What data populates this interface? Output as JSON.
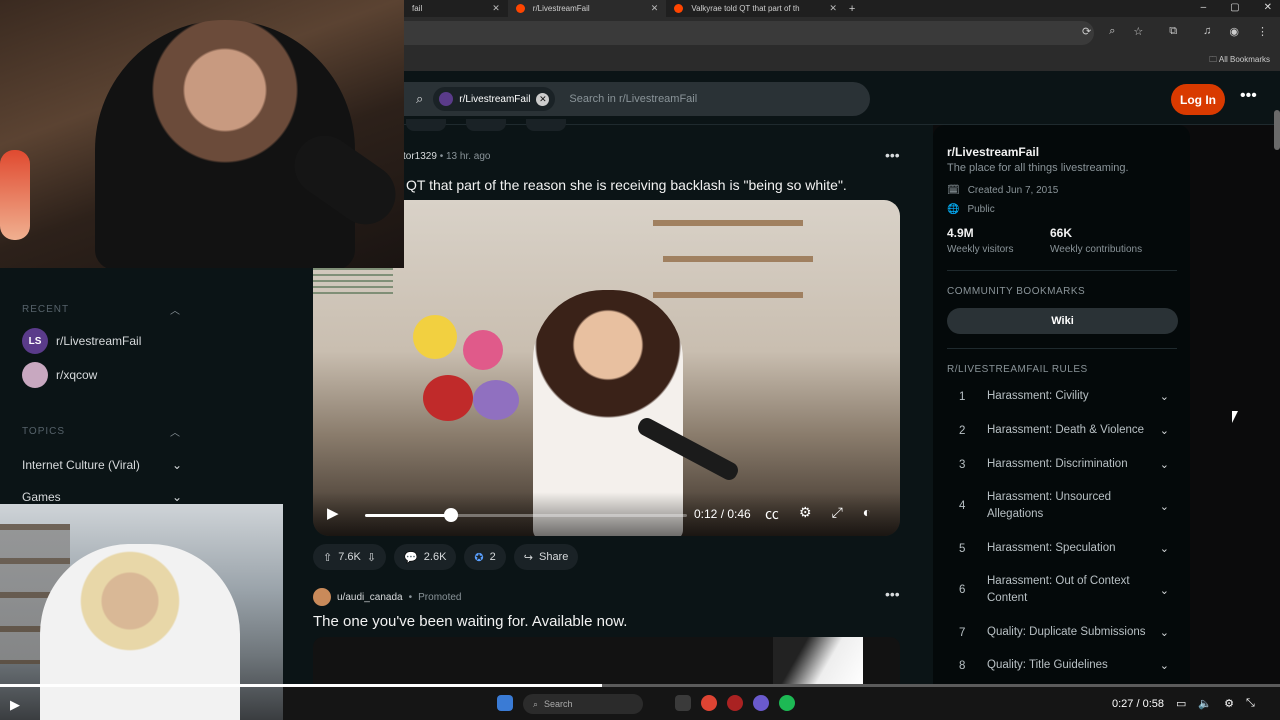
{
  "browser": {
    "tabs": [
      {
        "label": "fail"
      },
      {
        "label": "r/LivestreamFail",
        "active": true
      },
      {
        "label": "Valkyrae told QT that part of th"
      }
    ],
    "new_tab": "+",
    "bookmarks_label": "All Bookmarks"
  },
  "header": {
    "community_chip": "r/LivestreamFail",
    "search_placeholder": "Search in r/LivestreamFail",
    "login_label": "Log In",
    "menu_glyph": "•••"
  },
  "left_sidebar": {
    "recent_heading": "RECENT",
    "recent": [
      {
        "label": "r/LivestreamFail",
        "avatar": "LS",
        "color": "#5a3b8a"
      },
      {
        "label": "r/xqcow",
        "avatar": "",
        "color": "#c8a8c0"
      }
    ],
    "topics_heading": "TOPICS",
    "topics": [
      {
        "label": "Internet Culture (Viral)"
      },
      {
        "label": "Games"
      }
    ]
  },
  "post": {
    "author": "tor1329",
    "time": "13 hr. ago",
    "title": "QT that part of the reason she is receiving backlash is \"being so white\".",
    "video": {
      "time": "0:12 / 0:46",
      "progress": 0.26
    },
    "upvotes": "7.6K",
    "comments": "2.6K",
    "awards": "2",
    "share_label": "Share"
  },
  "promoted": {
    "author": "u/audi_canada",
    "tag": "Promoted",
    "title": "The one you've been waiting for. Available now."
  },
  "right_sidebar": {
    "title": "r/LivestreamFail",
    "description": "The place for all things livestreaming.",
    "created": "Created Jun 7, 2015",
    "visibility": "Public",
    "stats": [
      {
        "value": "4.9M",
        "label": "Weekly visitors"
      },
      {
        "value": "66K",
        "label": "Weekly contributions"
      }
    ],
    "bookmarks_heading": "COMMUNITY BOOKMARKS",
    "wiki_label": "Wiki",
    "rules_heading": "R/LIVESTREAMFAIL RULES",
    "rules": [
      {
        "n": "1",
        "text": "Harassment: Civility"
      },
      {
        "n": "2",
        "text": "Harassment: Death & Violence"
      },
      {
        "n": "3",
        "text": "Harassment: Discrimination"
      },
      {
        "n": "4",
        "text": "Harassment: Unsourced Allegations"
      },
      {
        "n": "5",
        "text": "Harassment: Speculation"
      },
      {
        "n": "6",
        "text": "Harassment: Out of Context Content"
      },
      {
        "n": "7",
        "text": "Quality: Duplicate Submissions"
      },
      {
        "n": "8",
        "text": "Quality: Title Guidelines"
      }
    ]
  },
  "player": {
    "time": "0:27 / 0:58",
    "progress": 0.47
  },
  "taskbar": {
    "search_label": "Search"
  }
}
